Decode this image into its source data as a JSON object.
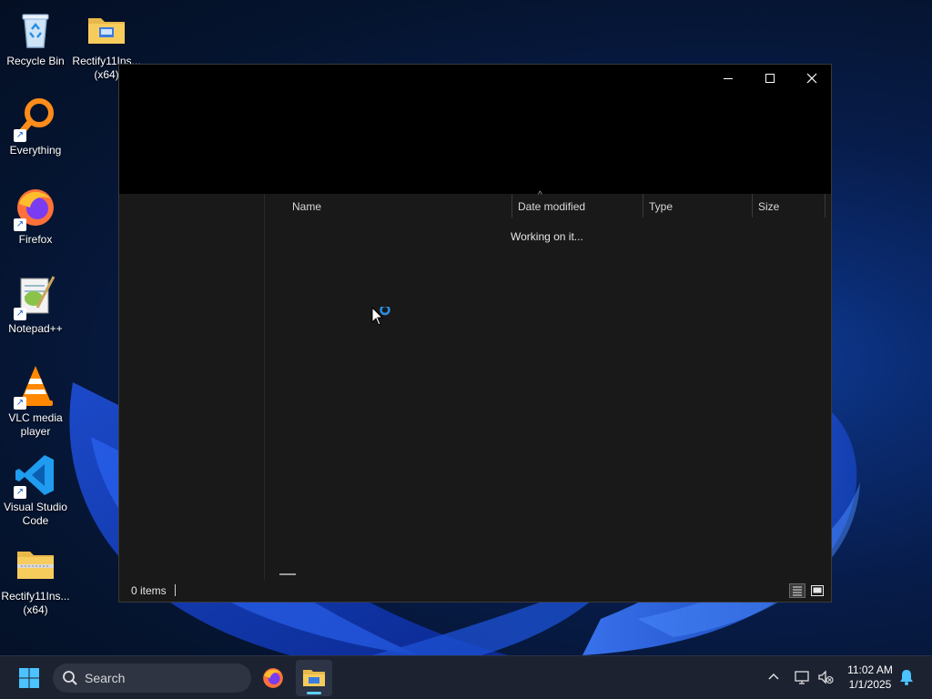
{
  "desktop": {
    "icons": [
      {
        "label": "Recycle Bin",
        "icon": "recycle-bin-icon"
      },
      {
        "label": "Rectify11Ins...\n(x64)",
        "icon": "folder-icon"
      },
      {
        "label": "Everything",
        "icon": "everything-search-icon"
      },
      {
        "label": "Firefox",
        "icon": "firefox-icon"
      },
      {
        "label": "Notepad++",
        "icon": "notepad-plus-plus-icon"
      },
      {
        "label": "VLC media\nplayer",
        "icon": "vlc-icon"
      },
      {
        "label": "Visual Studio\nCode",
        "icon": "vscode-icon"
      },
      {
        "label": "Rectify11Ins...\n(x64)",
        "icon": "zip-folder-icon"
      }
    ]
  },
  "explorer": {
    "window_controls": {
      "minimize": "minimize-icon",
      "maximize": "maximize-icon",
      "close": "close-icon"
    },
    "columns": {
      "name": "Name",
      "date_modified": "Date modified",
      "type": "Type",
      "size": "Size"
    },
    "sort_caret": "^",
    "loading_text": "Working on it...",
    "status": {
      "item_count": "0 items"
    },
    "views": [
      "details-view-icon",
      "large-icons-view-icon"
    ]
  },
  "taskbar": {
    "start": "windows-start-icon",
    "search_label": "Search",
    "apps": [
      "firefox-icon",
      "file-explorer-icon"
    ],
    "tray": [
      "chevron-up-icon",
      "network-icon",
      "volume-muted-icon"
    ],
    "clock": {
      "time": "11:02 AM",
      "date": "1/1/2025"
    },
    "notification": "bell-icon"
  },
  "colors": {
    "accent": "#60cdff",
    "window_bg": "#191919",
    "titlebar_bg": "#000000",
    "taskbar_bg": "#1c2230"
  }
}
